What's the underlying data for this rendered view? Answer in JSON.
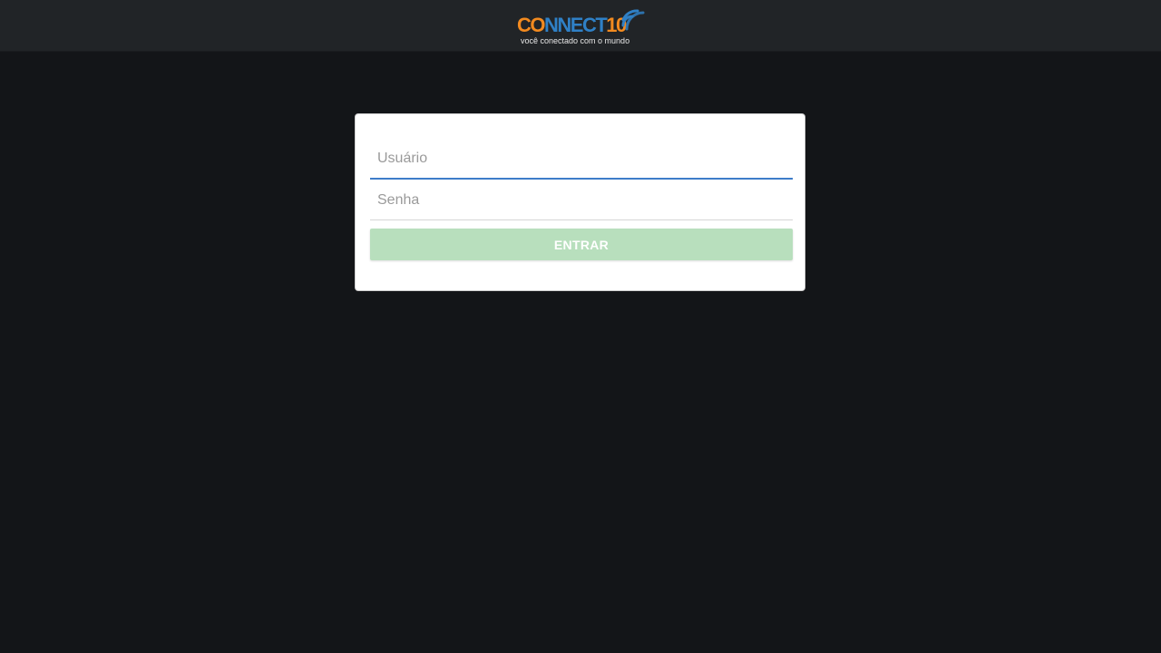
{
  "header": {
    "logo": {
      "part1": "CO",
      "part2": "NNECT",
      "part3": "10",
      "tagline": "você conectado com o mundo"
    }
  },
  "login": {
    "username_placeholder": "Usuário",
    "username_value": "",
    "password_placeholder": "Senha",
    "password_value": "",
    "submit_label": "ENTRAR"
  },
  "colors": {
    "background": "#131518",
    "header": "#212427",
    "logo_orange": "#f28a1f",
    "logo_blue": "#2f80c6",
    "focus_underline": "#3d7cc9",
    "button": "#b8dfbd"
  },
  "icons": {
    "logo_signal": "wifi-signal-icon"
  }
}
